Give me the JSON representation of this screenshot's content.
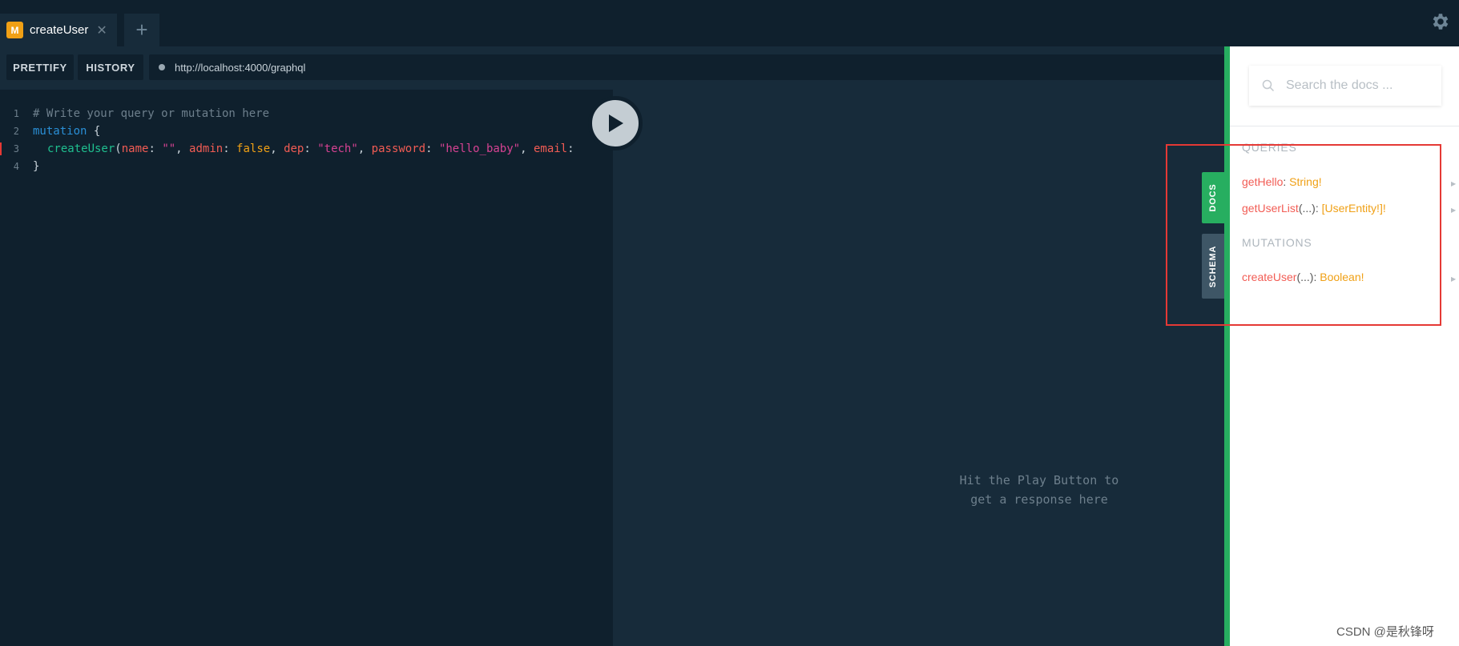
{
  "tab": {
    "badge": "M",
    "title": "createUser",
    "close": "✕",
    "add": "+"
  },
  "toolbar": {
    "prettify": "PRETTIFY",
    "history": "HISTORY",
    "url": "http://localhost:4000/graphql"
  },
  "editor": {
    "line_numbers": [
      "1",
      "2",
      "3",
      "4"
    ],
    "line1": "# Write your query or mutation here",
    "line2_kw": "mutation",
    "line2_brace": " {",
    "line3": {
      "fn": "createUser",
      "open": "(",
      "name_key": "name",
      "colon": ": ",
      "name_val": "\"\"",
      "comma": ", ",
      "admin_key": "admin",
      "admin_val": "false",
      "dep_key": "dep",
      "dep_val": "\"tech\"",
      "password_key": "password",
      "password_val": "\"hello_baby\"",
      "email_key": "email",
      "email_colon": ":"
    },
    "line4": "}"
  },
  "response": {
    "hint": "Hit the Play Button to\nget a response here"
  },
  "side_tabs": {
    "docs": "DOCS",
    "schema": "SCHEMA"
  },
  "docs": {
    "search_placeholder": "Search the docs ...",
    "queries_title": "QUERIES",
    "mutations_title": "MUTATIONS",
    "queries": [
      {
        "name": "getHello",
        "args": "",
        "sep": ": ",
        "type": "String!"
      },
      {
        "name": "getUserList",
        "args": "(...)",
        "sep": ": ",
        "type": "[UserEntity!]!"
      }
    ],
    "mutations": [
      {
        "name": "createUser",
        "args": "(...)",
        "sep": ": ",
        "type": "Boolean!"
      }
    ]
  },
  "watermark": "CSDN @是秋锋呀",
  "colors": {
    "docs_tab": "#27ae60",
    "schema_tab": "#3e5666",
    "accent_orange": "#f0a015",
    "annotation_red": "#e53935"
  }
}
